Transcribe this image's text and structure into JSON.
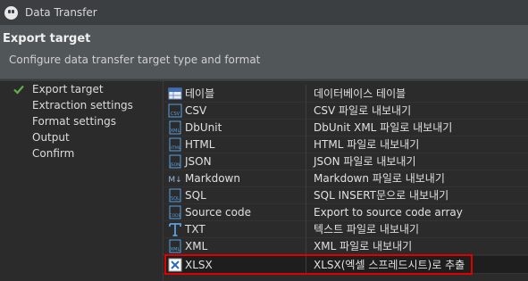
{
  "window": {
    "title": "Data Transfer"
  },
  "header": {
    "title": "Export target",
    "description": "Configure data transfer target type and format"
  },
  "nav": {
    "items": [
      {
        "label": "Export target",
        "active": true
      },
      {
        "label": "Extraction settings"
      },
      {
        "label": "Format settings"
      },
      {
        "label": "Output"
      },
      {
        "label": "Confirm"
      }
    ]
  },
  "formats": [
    {
      "name": "테이블",
      "description": "데이터베이스 테이블",
      "icon": "table-icon"
    },
    {
      "name": "CSV",
      "description": "CSV 파일로 내보내기",
      "icon": "csv-icon"
    },
    {
      "name": "DbUnit",
      "description": "DbUnit XML 파일로 내보내기",
      "icon": "dbunit-icon"
    },
    {
      "name": "HTML",
      "description": "HTML 파일로 내보내기",
      "icon": "html-icon"
    },
    {
      "name": "JSON",
      "description": "JSON 파일로 내보내기",
      "icon": "json-icon"
    },
    {
      "name": "Markdown",
      "description": "Markdown 파일로 내보내기",
      "icon": "markdown-icon"
    },
    {
      "name": "SQL",
      "description": "SQL INSERT문으로 내보내기",
      "icon": "sql-icon"
    },
    {
      "name": "Source code",
      "description": "Export to source code array",
      "icon": "source-code-icon"
    },
    {
      "name": "TXT",
      "description": "텍스트 파일로 내보내기",
      "icon": "txt-icon"
    },
    {
      "name": "XML",
      "description": "XML 파일로 내보내기",
      "icon": "xml-icon"
    },
    {
      "name": "XLSX",
      "description": "XLSX(엑셀 스프레드시트)로 추출",
      "icon": "xlsx-icon",
      "selected": true
    }
  ],
  "colors": {
    "accent_check": "#5fb04a",
    "highlight": "#e00000",
    "header_bg": "#515658"
  }
}
